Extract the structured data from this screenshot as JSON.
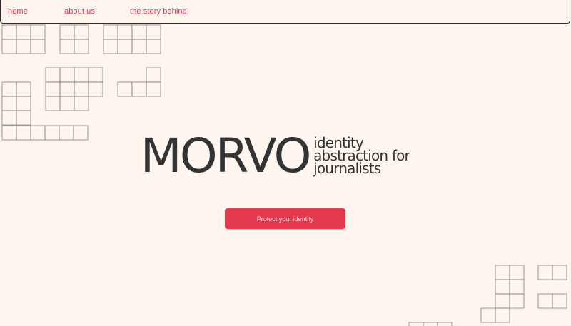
{
  "nav": {
    "items": [
      {
        "label": "home"
      },
      {
        "label": "about us"
      },
      {
        "label": "the story behind"
      }
    ]
  },
  "brand": {
    "name": "MORVO",
    "tagline": [
      "identity",
      "abstraction for",
      "journalists"
    ]
  },
  "cta": {
    "label": "Protect your identity"
  },
  "colors": {
    "background": "#fdf5ee",
    "accent": "#e4384f",
    "text": "#333333",
    "nav_link": "#e0344f"
  }
}
